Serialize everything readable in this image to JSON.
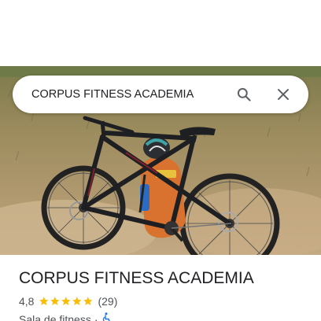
{
  "search": {
    "query": "CORPUS FITNESS ACADEMIA"
  },
  "icons": {
    "search": "search-icon",
    "close": "close-icon",
    "star": "star-icon",
    "accessibility": "wheelchair-icon"
  },
  "colors": {
    "star": "#fbbc04",
    "accessibility": "#1a73e8",
    "title": "#202124",
    "secondary_text": "#4d5156"
  },
  "place": {
    "title": "CORPUS FITNESS ACADEMIA",
    "rating": "4,8",
    "rating_value": 4.8,
    "stars": 5,
    "review_count": "(29)",
    "category": "Sala de fitness",
    "separator": "·"
  }
}
